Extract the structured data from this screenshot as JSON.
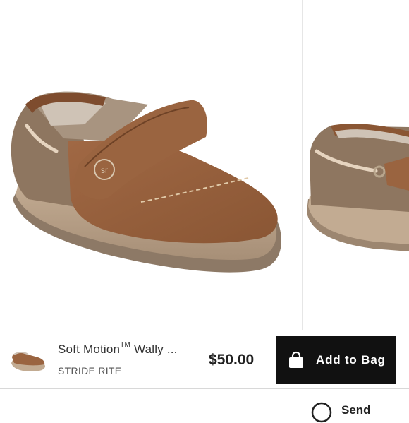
{
  "product": {
    "title": "Soft Motion",
    "trademark": "TM",
    "title_suffix": " Wally ...",
    "brand": "STRIDE RITE",
    "price": "$50.00",
    "image_subject": "shoe"
  },
  "actions": {
    "add_to_bag": "Add to Bag",
    "share": "Send"
  },
  "colors": {
    "button_bg": "#111111",
    "button_text": "#ffffff",
    "leather": "#9a6440",
    "sole": "#b49c84",
    "canvas": "#8e7660"
  },
  "icons": {
    "bag": "shopping-bag-icon",
    "share": "share-icon"
  }
}
